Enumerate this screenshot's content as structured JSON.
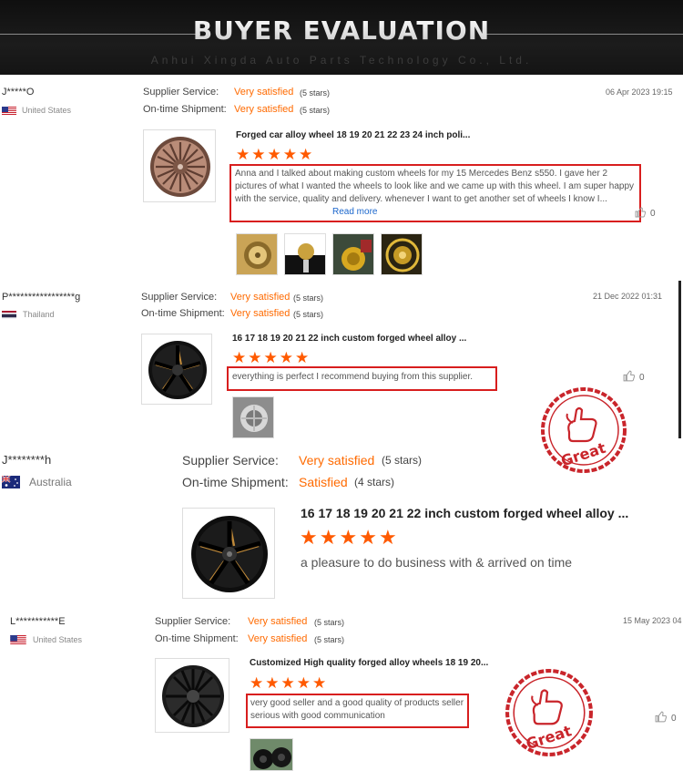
{
  "header": {
    "title": "BUYER EVALUATION",
    "subtitle": "Anhui Xingda Auto Parts Technology Co., Ltd."
  },
  "reviews": [
    {
      "user": "J*****O",
      "country": "United States",
      "supplier_label": "Supplier Service:",
      "supplier_value": "Very satisfied",
      "supplier_stars": "(5 stars)",
      "shipment_label": "On-time Shipment:",
      "shipment_value": "Very satisfied",
      "shipment_stars": "(5 stars)",
      "date": "06 Apr 2023 19:15",
      "product": "Forged car alloy wheel 18 19 20 21 22 23 24 inch poli...",
      "rating": 5,
      "comment": "Anna and I talked about making custom wheels for my 15 Mercedes Benz s550. I gave her 2 pictures of what I wanted the wheels to look like and we came up with this wheel. I am super happy with the service, quality and delivery. whenever I want to get another set of wheels I know I...",
      "read_more": "Read more",
      "likes": "0"
    },
    {
      "user": "P*****************g",
      "country": "Thailand",
      "supplier_label": "Supplier Service:",
      "supplier_value": "Very satisfied",
      "supplier_stars": "(5 stars)",
      "shipment_label": "On-time Shipment:",
      "shipment_value": "Very satisfied",
      "shipment_stars": "(5 stars)",
      "date": "21 Dec 2022 01:31",
      "product": "16 17 18 19 20 21 22 inch custom forged wheel alloy ...",
      "rating": 5,
      "comment": "everything is perfect I recommend buying from this supplier.",
      "likes": "0"
    },
    {
      "user": "J********h",
      "country": "Australia",
      "supplier_label": "Supplier Service:",
      "supplier_value": "Very satisfied",
      "supplier_stars": "(5 stars)",
      "shipment_label": "On-time Shipment:",
      "shipment_value": "Satisfied",
      "shipment_stars": "(4 stars)",
      "product": "16 17 18 19 20 21 22 inch custom forged wheel alloy ...",
      "rating": 5,
      "comment": "a pleasure to do business with & arrived on time"
    },
    {
      "user": "L***********E",
      "country": "United States",
      "supplier_label": "Supplier Service:",
      "supplier_value": "Very satisfied",
      "supplier_stars": "(5 stars)",
      "shipment_label": "On-time Shipment:",
      "shipment_value": "Very satisfied",
      "shipment_stars": "(5 stars)",
      "date": "15 May 2023 04",
      "product": "Customized High quality forged alloy wheels 18 19 20...",
      "rating": 5,
      "comment": "very good seller and a good quality of products seller serious with good communication",
      "likes": "0"
    }
  ],
  "stamp": {
    "text": "Great"
  },
  "colors": {
    "accent": "#ff6a00",
    "star": "#ff5a00",
    "highlight": "#d81e1e",
    "stamp": "#c9252b"
  },
  "icons": {
    "like": "thumb-up-icon",
    "star": "star-icon"
  }
}
